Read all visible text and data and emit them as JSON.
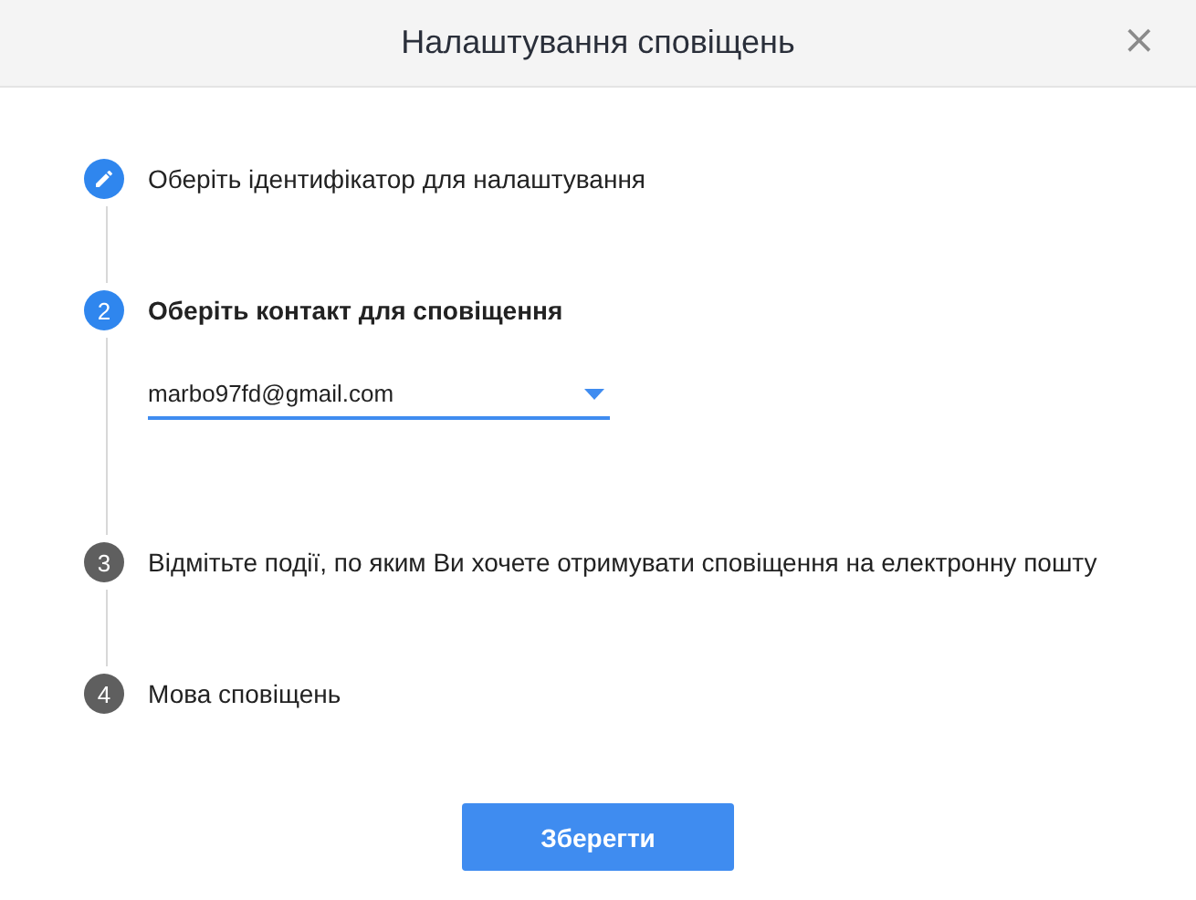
{
  "dialog": {
    "title": "Налаштування сповіщень",
    "close": "×"
  },
  "steps": [
    {
      "kind": "done",
      "label": "Оберіть ідентифікатор для налаштування",
      "active": false
    },
    {
      "kind": "number",
      "number": "2",
      "label": "Оберіть контакт для сповіщення",
      "active": true,
      "select": {
        "value": "marbo97fd@gmail.com"
      }
    },
    {
      "kind": "number",
      "number": "3",
      "label": "Відмітьте події, по яким Ви хочете отримувати сповіщення на електронну пошту",
      "active": false
    },
    {
      "kind": "number",
      "number": "4",
      "label": "Мова сповіщень",
      "active": false
    }
  ],
  "save_button": "Зберегти"
}
